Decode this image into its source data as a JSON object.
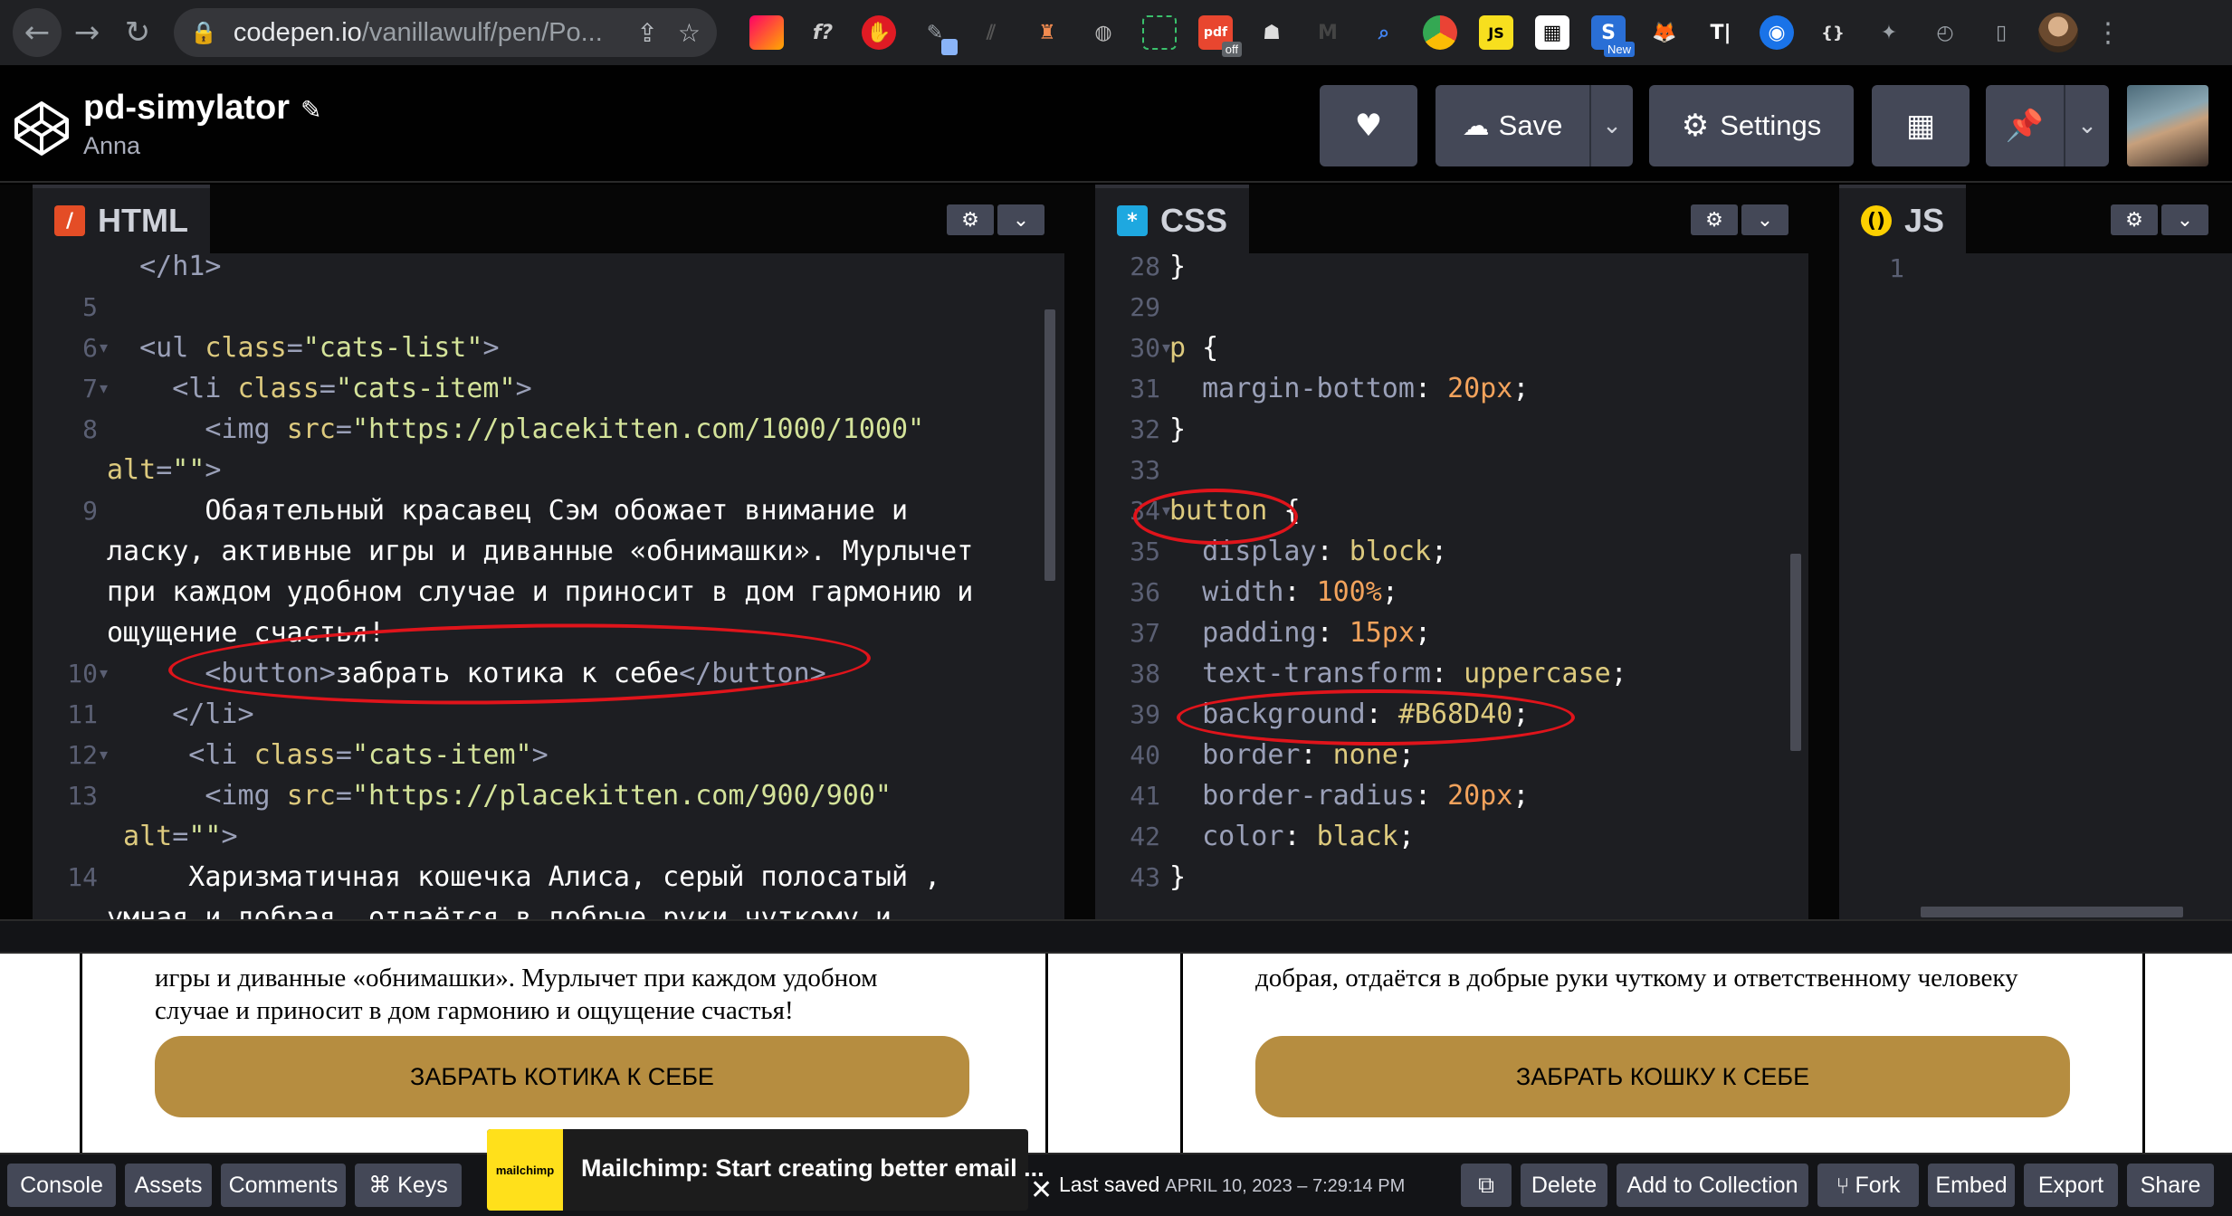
{
  "browser": {
    "url_host": "codepen.io",
    "url_path": "/vanillawulf/pen/Po...",
    "ext_badge_new": "New",
    "ext_badge_off": "off"
  },
  "header": {
    "title": "pd-simylator",
    "author": "Anna",
    "save_label": "Save",
    "settings_label": "Settings"
  },
  "html_pane": {
    "tab_label": "HTML",
    "lines": [
      {
        "n": "",
        "segs": [
          [
            "tag",
            "  </h1>"
          ]
        ]
      },
      {
        "n": "5",
        "segs": []
      },
      {
        "n": "6",
        "fold": true,
        "segs": [
          [
            "tag",
            "  <ul "
          ],
          [
            "attr",
            "class"
          ],
          [
            "tag",
            "="
          ],
          [
            "str",
            "\"cats-list\""
          ],
          [
            "tag",
            ">"
          ]
        ]
      },
      {
        "n": "7",
        "fold": true,
        "segs": [
          [
            "tag",
            "    <li "
          ],
          [
            "attr",
            "class"
          ],
          [
            "tag",
            "="
          ],
          [
            "str",
            "\"cats-item\""
          ],
          [
            "tag",
            ">"
          ]
        ]
      },
      {
        "n": "8",
        "segs": [
          [
            "tag",
            "      <img "
          ],
          [
            "attr",
            "src"
          ],
          [
            "tag",
            "="
          ],
          [
            "str",
            "\"https://placekitten.com/1000/1000\""
          ]
        ]
      },
      {
        "n": "",
        "segs": [
          [
            "attr",
            "alt"
          ],
          [
            "tag",
            "="
          ],
          [
            "str",
            "\"\""
          ],
          [
            "tag",
            ">"
          ]
        ]
      },
      {
        "n": "9",
        "segs": [
          [
            "plain",
            "      Обаятельный красавец Сэм обожает внимание и"
          ]
        ]
      },
      {
        "n": "",
        "segs": [
          [
            "plain",
            "ласку, активные игры и диванные «обнимашки». Мурлычет"
          ]
        ]
      },
      {
        "n": "",
        "segs": [
          [
            "plain",
            "при каждом удобном случае и приносит в дом гармонию и"
          ]
        ]
      },
      {
        "n": "",
        "segs": [
          [
            "plain",
            "ощущение счастья!"
          ]
        ]
      },
      {
        "n": "10",
        "fold": true,
        "segs": [
          [
            "tag",
            "      <button>"
          ],
          [
            "plain",
            "забрать котика к себе"
          ],
          [
            "tag",
            "</button>"
          ]
        ]
      },
      {
        "n": "11",
        "segs": [
          [
            "tag",
            "    </li>"
          ]
        ]
      },
      {
        "n": "12",
        "fold": true,
        "segs": [
          [
            "tag",
            "     <li "
          ],
          [
            "attr",
            "class"
          ],
          [
            "tag",
            "="
          ],
          [
            "str",
            "\"cats-item\""
          ],
          [
            "tag",
            ">"
          ]
        ]
      },
      {
        "n": "13",
        "segs": [
          [
            "tag",
            "      <img "
          ],
          [
            "attr",
            "src"
          ],
          [
            "tag",
            "="
          ],
          [
            "str",
            "\"https://placekitten.com/900/900\""
          ]
        ]
      },
      {
        "n": "",
        "segs": [
          [
            "attr",
            " alt"
          ],
          [
            "tag",
            "="
          ],
          [
            "str",
            "\"\""
          ],
          [
            "tag",
            ">"
          ]
        ]
      },
      {
        "n": "14",
        "segs": [
          [
            "plain",
            "     Харизматичная кошечка Алиса, серый полосатый ,"
          ]
        ]
      },
      {
        "n": "",
        "segs": [
          [
            "plain",
            "умная и добрая, отдаётся в добрые руки чуткому и"
          ]
        ]
      }
    ]
  },
  "css_pane": {
    "tab_label": "CSS",
    "lines": [
      {
        "n": "28",
        "segs": [
          [
            "plain",
            "}"
          ]
        ]
      },
      {
        "n": "29",
        "segs": []
      },
      {
        "n": "30",
        "fold": true,
        "segs": [
          [
            "sel",
            "p "
          ],
          [
            "plain",
            "{"
          ]
        ]
      },
      {
        "n": "31",
        "segs": [
          [
            "prop",
            "  margin-bottom"
          ],
          [
            "plain",
            ": "
          ],
          [
            "num",
            "20px"
          ],
          [
            "plain",
            ";"
          ]
        ]
      },
      {
        "n": "32",
        "segs": [
          [
            "plain",
            "}"
          ]
        ]
      },
      {
        "n": "33",
        "segs": []
      },
      {
        "n": "34",
        "fold": true,
        "segs": [
          [
            "sel",
            "button "
          ],
          [
            "plain",
            "{"
          ]
        ]
      },
      {
        "n": "35",
        "segs": [
          [
            "prop",
            "  display"
          ],
          [
            "plain",
            ": "
          ],
          [
            "val",
            "block"
          ],
          [
            "plain",
            ";"
          ]
        ]
      },
      {
        "n": "36",
        "segs": [
          [
            "prop",
            "  width"
          ],
          [
            "plain",
            ": "
          ],
          [
            "num",
            "100%"
          ],
          [
            "plain",
            ";"
          ]
        ]
      },
      {
        "n": "37",
        "segs": [
          [
            "prop",
            "  padding"
          ],
          [
            "plain",
            ": "
          ],
          [
            "num",
            "15px"
          ],
          [
            "plain",
            ";"
          ]
        ]
      },
      {
        "n": "38",
        "segs": [
          [
            "prop",
            "  text-transform"
          ],
          [
            "plain",
            ": "
          ],
          [
            "val",
            "uppercase"
          ],
          [
            "plain",
            ";"
          ]
        ]
      },
      {
        "n": "39",
        "segs": [
          [
            "prop",
            "  background"
          ],
          [
            "plain",
            ": "
          ],
          [
            "val",
            "#B68D40"
          ],
          [
            "plain",
            ";"
          ]
        ]
      },
      {
        "n": "40",
        "segs": [
          [
            "prop",
            "  border"
          ],
          [
            "plain",
            ": "
          ],
          [
            "val",
            "none"
          ],
          [
            "plain",
            ";"
          ]
        ]
      },
      {
        "n": "41",
        "segs": [
          [
            "prop",
            "  border-radius"
          ],
          [
            "plain",
            ": "
          ],
          [
            "num",
            "20px"
          ],
          [
            "plain",
            ";"
          ]
        ]
      },
      {
        "n": "42",
        "segs": [
          [
            "prop",
            "  color"
          ],
          [
            "plain",
            ": "
          ],
          [
            "val",
            "black"
          ],
          [
            "plain",
            ";"
          ]
        ]
      },
      {
        "n": "43",
        "segs": [
          [
            "plain",
            "}"
          ]
        ]
      }
    ]
  },
  "js_pane": {
    "tab_label": "JS",
    "lines": [
      {
        "n": "1",
        "segs": []
      }
    ]
  },
  "preview": {
    "card1_text": "игры и диванные «обнимашки». Мурлычет при каждом удобном случае и приносит в дом гармонию и ощущение счастья!",
    "card1_button": "забрать котика к себе",
    "card2_text": "добрая, отдаётся в добрые руки чуткому и ответственному человеку",
    "card2_button": "забрать кошку к себе",
    "button_color": "#B68D40"
  },
  "footer": {
    "console": "Console",
    "assets": "Assets",
    "comments": "Comments",
    "keys": "⌘ Keys",
    "ad_text": "Mailchimp: Start creating better email ...",
    "ad_logo": "mailchimp",
    "last_saved_label": "Last saved",
    "last_saved_date": "APRIL 10, 2023 – 7:29:14 PM",
    "delete": "Delete",
    "add_to_collection": "Add to Collection",
    "fork": "Fork",
    "embed": "Embed",
    "export": "Export",
    "share": "Share"
  }
}
